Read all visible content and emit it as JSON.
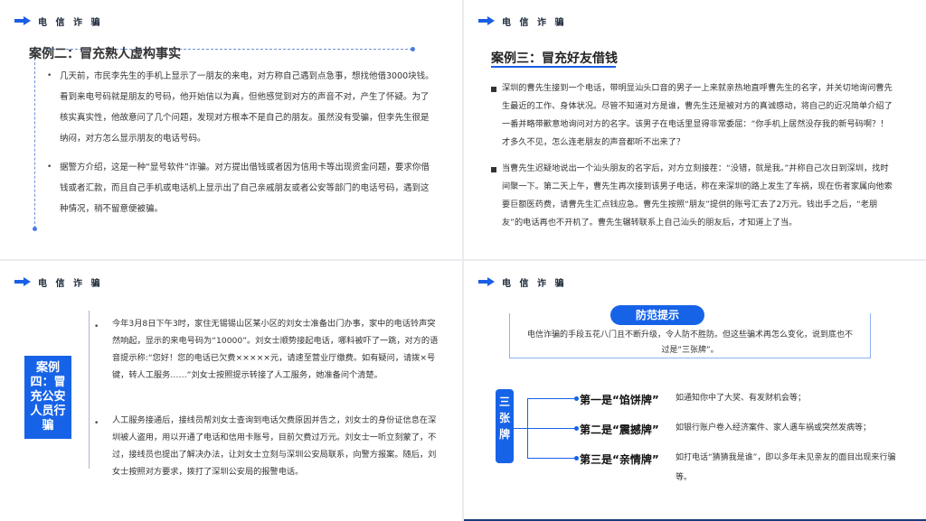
{
  "header": "电 信 诈 骗",
  "slide1": {
    "title": "案例二：冒充熟人虚构事实",
    "bullet": "•",
    "p1": "几天前，市民李先生的手机上显示了一朋友的来电，对方称自己遇到点急事，想找他借3000块钱。看到来电号码就是朋友的号码，他开始信以为真，但他感觉到对方的声音不对，产生了怀疑。为了核实真实性，他故意问了几个问题，发现对方根本不是自己的朋友。虽然没有受骗，但李先生很是纳闷，对方怎么显示朋友的电话号码。",
    "p2": "据警方介绍，这是一种“显号软件”诈骗。对方提出借钱或者因为信用卡等出现资金问题，要求你借钱或者汇款，而且自己手机或电话机上显示出了自己亲戚朋友或者公安等部门的电话号码，遇到这种情况，稍不留意便被骗。"
  },
  "slide2": {
    "title": "案例三：冒充好友借钱",
    "p1": "深圳的曹先生接到一个电话，带明显汕头口音的男子一上来就亲热地直呼曹先生的名字，并关切地询问曹先生最近的工作、身体状况。尽管不知道对方是谁，曹先生还是被对方的真诚感动，将自己的近况简单介绍了一番并略带歉意地询问对方的名字。该男子在电话里显得非常委屈：“你手机上居然没存我的新号码啊？！才多久不见，怎么连老朋友的声音都听不出来了？",
    "p2": "当曹先生迟疑地说出一个汕头朋友的名字后，对方立刻接茬：“没错，就是我。”并称自己次日到深圳，找时间聚一下。第二天上午，曹先生再次接到该男子电话，称在来深圳的路上发生了车祸，现在伤者家属向他索要巨额医药费，请曹先生汇点钱应急。曹先生按照“朋友”提供的账号汇去了2万元。钱出手之后，“老朋友”的电话再也不开机了。曹先生辗转联系上自己汕头的朋友后，才知道上了当。"
  },
  "slide3": {
    "label": "案例四：冒充公安人员行骗",
    "bullet": "•",
    "p1": "今年3月8日下午3时，家住无锡锡山区某小区的刘女士准备出门办事，家中的电话铃声突然响起，显示的来电号码为“10000”。刘女士顺势接起电话，哪料被吓了一跳，对方的语音提示称:“您好！您的电话已欠费×××××元，请速至营业厅缴费。如有疑问，请拨×号键，转人工服务……”刘女士按照提示转接了人工服务，她准备问个清楚。",
    "p2": "人工服务接通后，接线员帮刘女士查询到电话欠费原因并告之，刘女士的身份证信息在深圳被人盗用，用以开通了电话和信用卡账号，目前欠费过万元。刘女士一听立刻蒙了，不过，接线员也提出了解决办法，让刘女士立刻与深圳公安局联系，向警方报案。随后，刘女士按照对方要求，拨打了深圳公安局的报警电话。"
  },
  "slide4": {
    "tip_title": "防范提示",
    "tip_text": "电信诈骗的手段五花八门且不断升级，令人防不胜防。但这些骗术再怎么变化，说到底也不过是“三张牌”。",
    "tab": "三张牌",
    "cards": [
      {
        "name": "第一是“馅饼牌”",
        "desc": "如通知你中了大奖、有发财机会等；"
      },
      {
        "name": "第二是“震撼牌”",
        "desc": "如银行账户卷入经济案件、家人遇车祸或突然发病等；"
      },
      {
        "name": "第三是“亲情牌”",
        "desc": "如打电话“猜猜我是谁”，即以多年未见亲友的面目出现来行骗等。"
      }
    ]
  }
}
